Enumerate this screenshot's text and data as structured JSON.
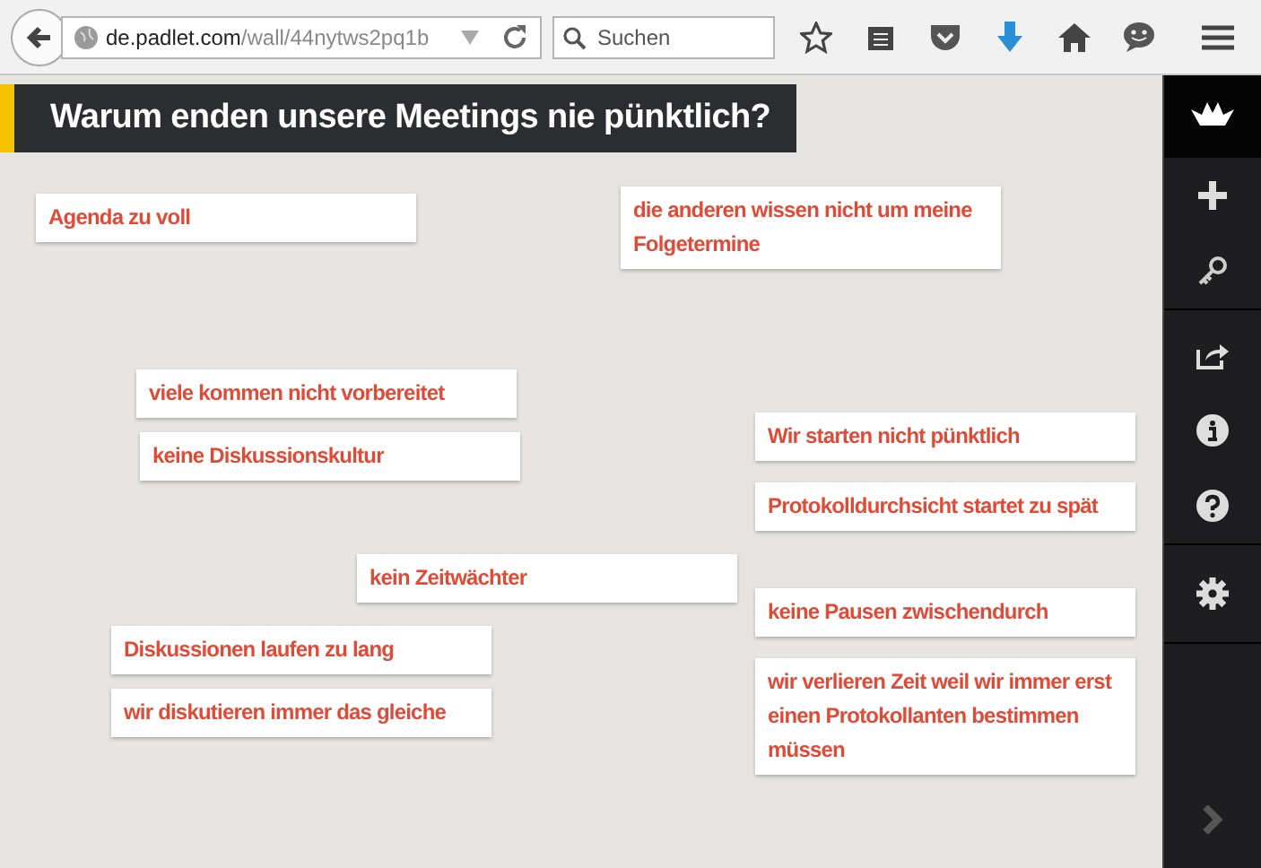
{
  "browser": {
    "url_host": "de.padlet.com",
    "url_path": "/wall/44nytws2pq1b",
    "search": {
      "placeholder": "Suchen"
    }
  },
  "wall": {
    "title": "Warum enden unsere Meetings nie pünktlich?"
  },
  "notes": [
    {
      "text": "Agenda zu voll"
    },
    {
      "text": "die anderen wissen nicht um meine Folgetermine"
    },
    {
      "text": "viele kommen nicht vorbereitet"
    },
    {
      "text": "keine Diskussionskultur"
    },
    {
      "text": "Wir starten nicht pünktlich"
    },
    {
      "text": "kein Zeitwächter"
    },
    {
      "text": "Protokolldurchsicht startet zu spät"
    },
    {
      "text": "Diskussionen laufen zu lang"
    },
    {
      "text": "keine Pausen zwischendurch"
    },
    {
      "text": "wir diskutieren immer das gleiche"
    },
    {
      "text": "wir verlieren Zeit weil wir immer erst einen Protokollanten bestimmen müssen"
    }
  ]
}
